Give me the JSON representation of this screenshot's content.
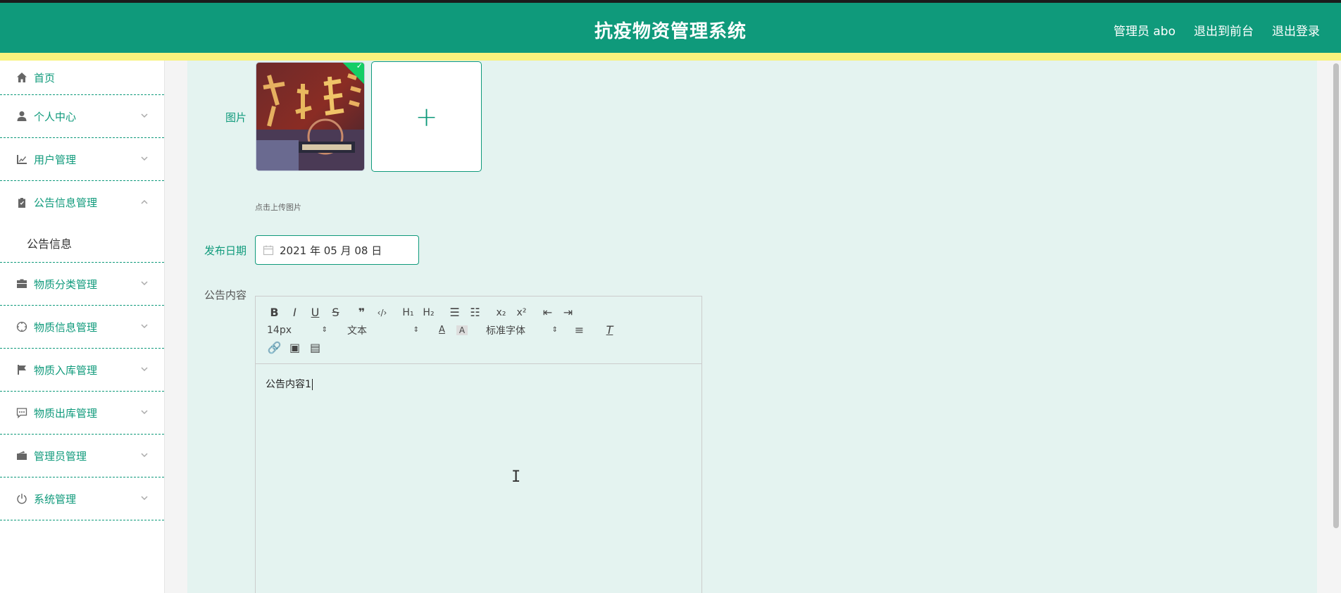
{
  "header": {
    "title": "抗疫物资管理系统",
    "admin": "管理员 abo",
    "front": "退出到前台",
    "logout": "退出登录",
    "bg_color": "#0f9a7b",
    "accent_bar_color": "#f8f27d"
  },
  "sidebar": {
    "items": [
      {
        "label": "首页",
        "icon": "home-icon"
      },
      {
        "label": "个人中心",
        "icon": "user-icon"
      },
      {
        "label": "用户管理",
        "icon": "chart-icon"
      },
      {
        "label": "公告信息管理",
        "icon": "clipboard-icon",
        "expanded": true
      },
      {
        "label": "物质分类管理",
        "icon": "briefcase-icon"
      },
      {
        "label": "物质信息管理",
        "icon": "compass-icon"
      },
      {
        "label": "物质入库管理",
        "icon": "flag-icon"
      },
      {
        "label": "物质出库管理",
        "icon": "chat-icon"
      },
      {
        "label": "管理员管理",
        "icon": "wallet-icon"
      },
      {
        "label": "系统管理",
        "icon": "power-icon"
      }
    ],
    "submenu": {
      "label": "公告信息"
    }
  },
  "form": {
    "image_label": "图片",
    "upload_hint": "点击上传图片",
    "date_label": "发布日期",
    "date_value": "2021 年 05 月 08 日",
    "content_label": "公告内容",
    "content_value": "公告内容1"
  },
  "editor_toolbar": {
    "font_size": "14px",
    "header_select": "文本",
    "font_family": "标准字体"
  }
}
